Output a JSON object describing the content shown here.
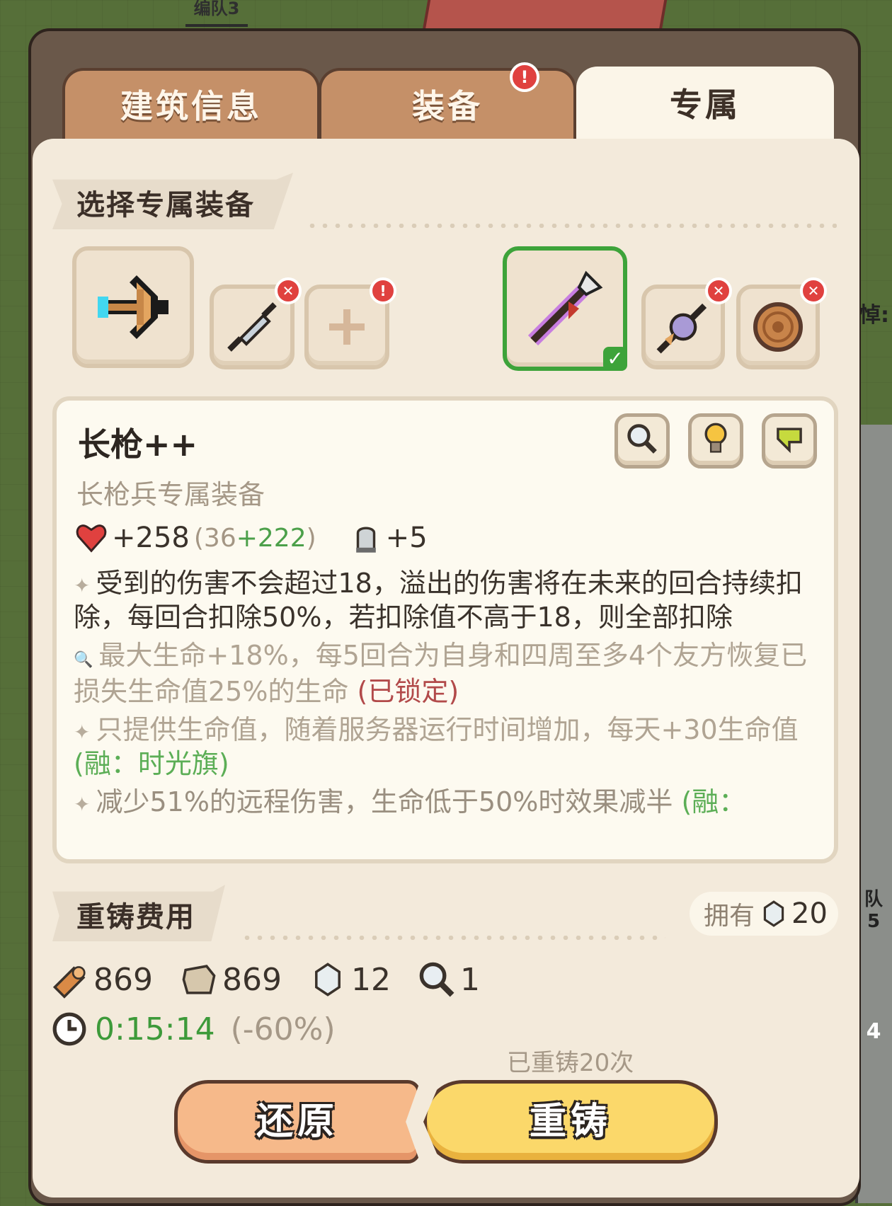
{
  "background": {
    "team_tag_top": "编队3",
    "team_tag_right": "队5",
    "right_digit": "4",
    "right_glyph": "悼:"
  },
  "tabs": [
    {
      "label": "建筑信息",
      "active": false,
      "alert": false
    },
    {
      "label": "装备",
      "active": false,
      "alert": true
    },
    {
      "label": "专属",
      "active": true,
      "alert": false
    }
  ],
  "select_section": {
    "title": "选择专属装备"
  },
  "slots": [
    {
      "icon": "crossbow-icon",
      "state": "equipped-large"
    },
    {
      "icon": "feather-spear-icon",
      "state": "remove"
    },
    {
      "icon": "plus-icon",
      "state": "alert"
    },
    {
      "icon": "long-spear-icon",
      "state": "selected"
    },
    {
      "icon": "flag-spear-icon",
      "state": "remove"
    },
    {
      "icon": "round-shield-icon",
      "state": "remove"
    }
  ],
  "item": {
    "name": "长枪++",
    "subtitle": "长枪兵专属装备",
    "hp_bonus": "+258",
    "hp_detail_open": "(",
    "hp_base": "36",
    "hp_extra": "+222",
    "hp_detail_close": ")",
    "armor_bonus": "+5",
    "effects": [
      {
        "mark": "✦",
        "text": "受到的伤害不会超过18，溢出的伤害将在未来的回合持续扣除，每回合扣除50%，若扣除值不高于18，则全部扣除",
        "tag": "",
        "style": "normal"
      },
      {
        "mark": "🔍",
        "text": "最大生命+18%，每5回合为自身和四周至多4个友方恢复已损失生命值25%的生命 ",
        "tag": "(已锁定)",
        "style": "locked"
      },
      {
        "mark": "✦",
        "text": "只提供生命值，随着服务器运行时间增加，每天+30生命值 ",
        "tag": "(融：时光旗)",
        "style": "fused"
      },
      {
        "mark": "✦",
        "text": "减少51%的远程伤害，生命低于50%时效果减半 ",
        "tag": "(融：",
        "style": "fused-fade"
      }
    ]
  },
  "recast_section": {
    "title": "重铸费用",
    "own_label": "拥有",
    "own_value": "20",
    "costs": [
      {
        "icon": "wood-icon",
        "value": "869"
      },
      {
        "icon": "stone-icon",
        "value": "869"
      },
      {
        "icon": "gem-icon",
        "value": "12"
      },
      {
        "icon": "magnifier-icon",
        "value": "1"
      }
    ],
    "time": "0:15:14",
    "time_discount": "(-60%)",
    "recast_count": "已重铸20次"
  },
  "buttons": {
    "restore": "还原",
    "recast": "重铸"
  },
  "colors": {
    "accent_green": "#3da33a",
    "alert_red": "#e0413f",
    "recast_yellow": "#fbd86a",
    "restore_orange": "#f6b98a"
  }
}
